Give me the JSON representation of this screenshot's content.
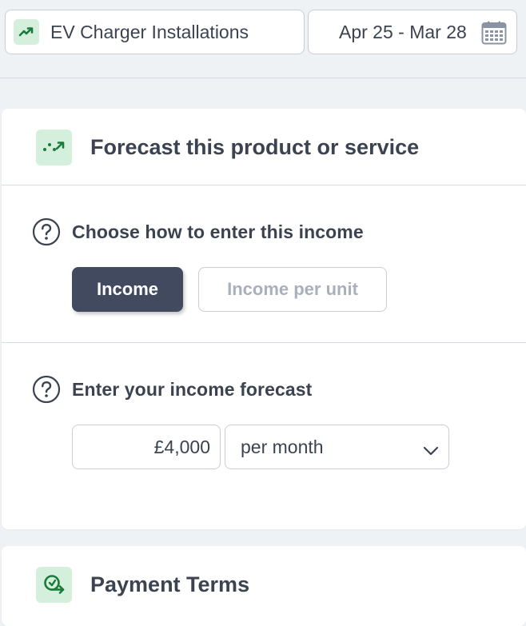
{
  "header": {
    "product": {
      "label": "EV Charger Installations",
      "icon": "trend-up-icon"
    },
    "date_range": {
      "label": "Apr 25 - Mar 28",
      "icon": "calendar-icon"
    }
  },
  "forecast_card": {
    "title": "Forecast this product or service",
    "icon": "forecast-trend-icon",
    "income_method": {
      "question": "Choose how to enter this income",
      "options": [
        {
          "label": "Income",
          "selected": true
        },
        {
          "label": "Income per unit",
          "selected": false
        }
      ]
    },
    "income_forecast": {
      "question": "Enter your income forecast",
      "amount": "£4,000",
      "period": "per month"
    }
  },
  "payment_card": {
    "title": "Payment Terms",
    "icon": "payment-terms-icon"
  },
  "colors": {
    "accent_green": "#1a7a3a",
    "icon_bg_green": "#d4efdc",
    "selected_button": "#414a5e",
    "text": "#3b4351",
    "muted_text": "#a9b0bc",
    "page_bg": "#eff2f5"
  }
}
